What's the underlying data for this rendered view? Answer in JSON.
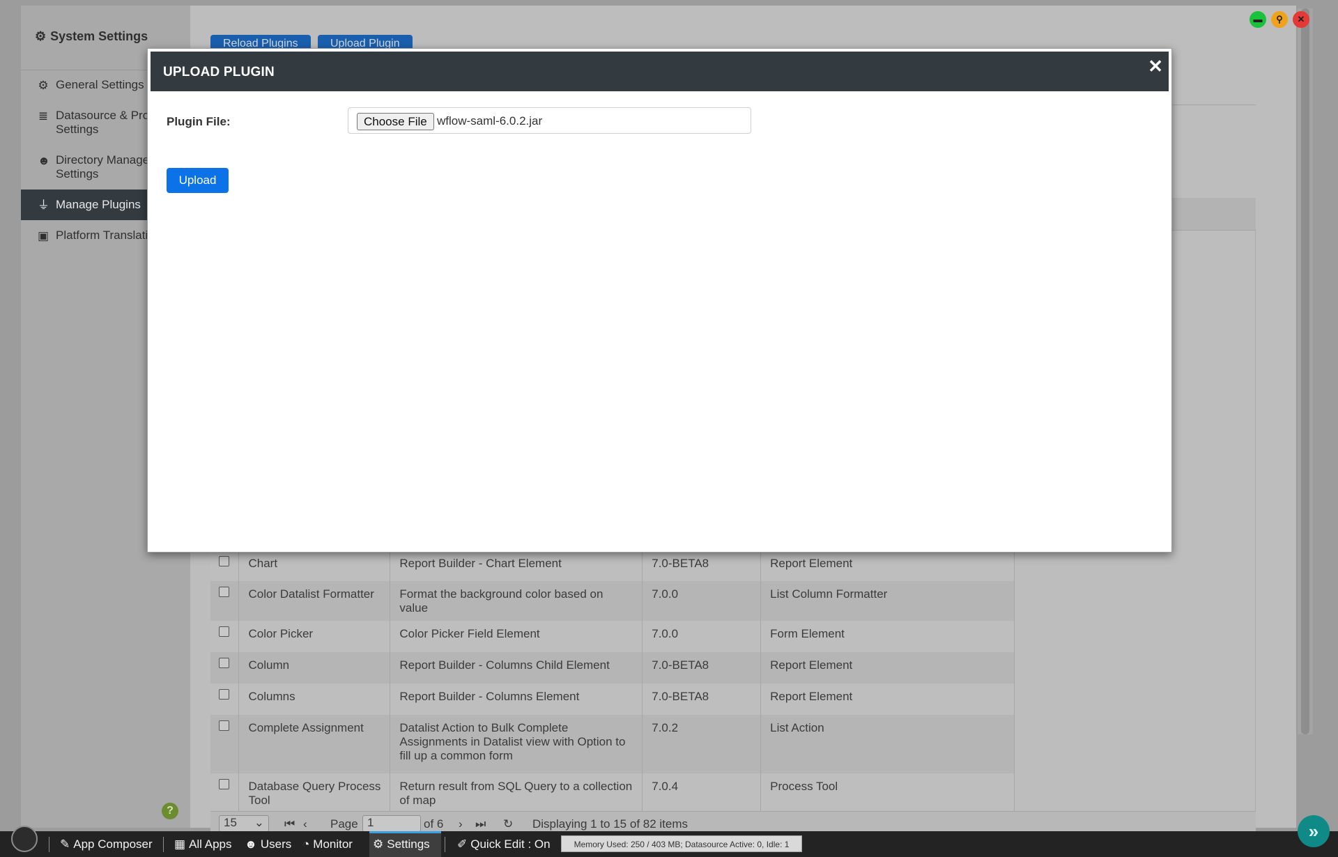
{
  "window": {
    "controls": [
      {
        "name": "minimize",
        "color": "#19c23a",
        "glyph": "▬"
      },
      {
        "name": "pin",
        "color": "#f0a21b",
        "glyph": "⚲"
      },
      {
        "name": "close",
        "color": "#e53935",
        "glyph": "✕"
      }
    ]
  },
  "sidebar": {
    "title": "System Settings",
    "items": [
      {
        "label": "General Settings",
        "icon": "gear-icon"
      },
      {
        "label": "Datasource & Pro",
        "label2": "Settings",
        "icon": "database-icon"
      },
      {
        "label": "Directory Manage",
        "label2": "Settings",
        "icon": "users-icon"
      },
      {
        "label": "Manage Plugins",
        "icon": "plug-icon",
        "active": true
      },
      {
        "label": "Platform Translati",
        "icon": "translate-icon"
      }
    ]
  },
  "toolbar": {
    "reload_label": "Reload Plugins",
    "upload_label": "Upload Plugin"
  },
  "plugins": {
    "rows": [
      {
        "name": "Chart",
        "description": "Report Builder - Chart Element",
        "version": "7.0-BETA8",
        "type": "Report Element"
      },
      {
        "name": "Color Datalist Formatter",
        "description": "Format the background color based on value",
        "version": "7.0.0",
        "type": "List Column Formatter"
      },
      {
        "name": "Color Picker",
        "description": "Color Picker Field Element",
        "version": "7.0.0",
        "type": "Form Element"
      },
      {
        "name": "Column",
        "description": "Report Builder - Columns Child Element",
        "version": "7.0-BETA8",
        "type": "Report Element"
      },
      {
        "name": "Columns",
        "description": "Report Builder - Columns Element",
        "version": "7.0-BETA8",
        "type": "Report Element"
      },
      {
        "name": "Complete Assignment",
        "description": "Datalist Action to Bulk Complete Assignments in Datalist view with Option to fill up a common form",
        "version": "7.0.2",
        "type": "List Action"
      },
      {
        "name": "Database Query Process Tool",
        "description": "Return result from SQL Query to a collection of map",
        "version": "7.0.4",
        "type": "Process Tool"
      }
    ]
  },
  "pager": {
    "page_size": "15",
    "page_label": "Page",
    "page": "1",
    "of_label": "of 6",
    "displaying": "Displaying 1 to 15 of 82 items"
  },
  "taskbar": {
    "app_composer": "App Composer",
    "all_apps": "All Apps",
    "users": "Users",
    "monitor": "Monitor",
    "settings": "Settings",
    "quick_edit": "Quick Edit : On",
    "memory": "Memory Used: 250 / 403 MB; Datasource Active: 0, Idle: 1"
  },
  "help_glyph": "?",
  "modal": {
    "title": "UPLOAD PLUGIN",
    "close_glyph": "✕",
    "field_label": "Plugin File:",
    "choose_file_label": "Choose File",
    "file_name": "wflow-saml-6.0.2.jar",
    "upload_label": "Upload"
  }
}
